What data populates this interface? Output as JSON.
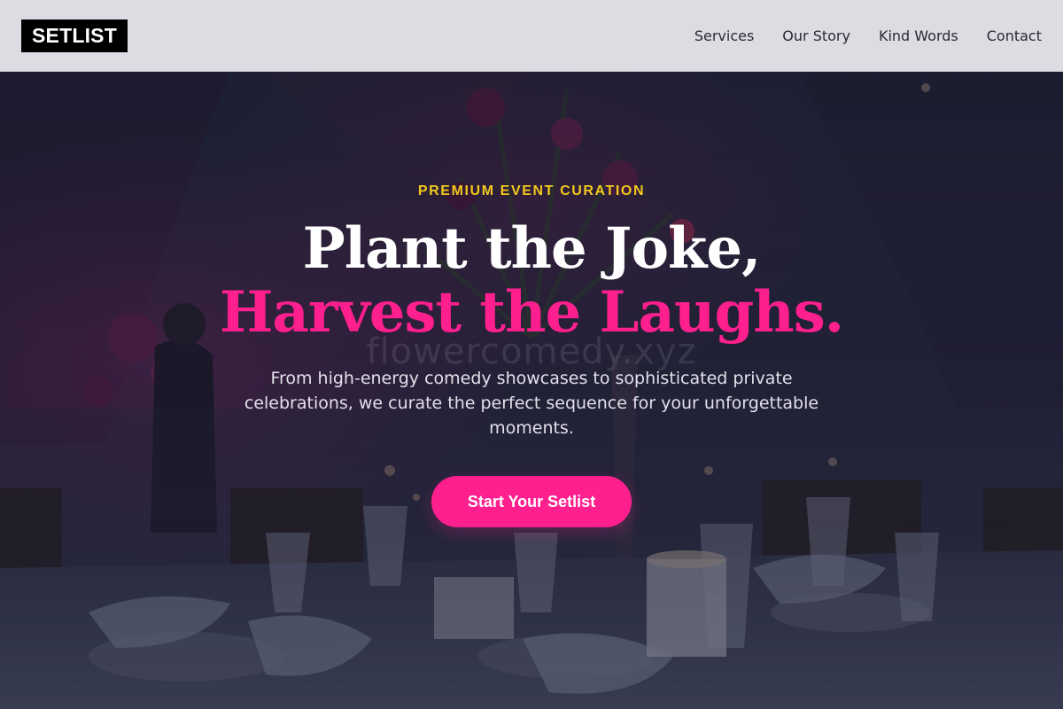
{
  "header": {
    "logo": "SETLIST",
    "nav": [
      {
        "label": "Services"
      },
      {
        "label": "Our Story"
      },
      {
        "label": "Kind Words"
      },
      {
        "label": "Contact"
      }
    ]
  },
  "hero": {
    "eyebrow": "PREMIUM EVENT CURATION",
    "headline_line1": "Plant the Joke,",
    "headline_line2": "Harvest the Laughs.",
    "watermark": "flowercomedy.xyz",
    "description": "From high-energy comedy showcases to sophisticated private celebrations, we curate the perfect sequence for your unforgettable moments.",
    "cta_label": "Start Your Setlist",
    "background_image": "dimly lit banquet table with glassware, candles and floral centerpiece"
  },
  "colors": {
    "accent": "#ff1f8e",
    "eyebrow": "#f2c81c",
    "header_bg": "#dcdde3",
    "logo_bg": "#000000"
  }
}
